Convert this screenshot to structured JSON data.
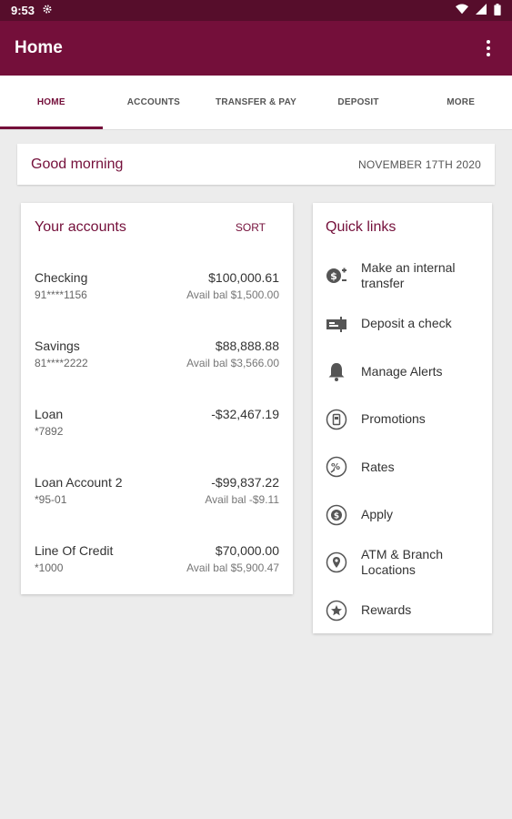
{
  "status": {
    "time": "9:53"
  },
  "appbar": {
    "title": "Home"
  },
  "tabs": [
    {
      "label": "HOME",
      "active": true
    },
    {
      "label": "ACCOUNTS"
    },
    {
      "label": "TRANSFER & PAY"
    },
    {
      "label": "DEPOSIT"
    },
    {
      "label": "MORE"
    }
  ],
  "greeting": {
    "text": "Good morning",
    "date": "NOVEMBER 17TH 2020"
  },
  "accounts": {
    "title": "Your accounts",
    "sort_label": "SORT",
    "items": [
      {
        "name": "Checking",
        "number": "91****1156",
        "amount": "$100,000.61",
        "avail": "Avail bal $1,500.00"
      },
      {
        "name": "Savings",
        "number": "81****2222",
        "amount": "$88,888.88",
        "avail": "Avail bal $3,566.00"
      },
      {
        "name": "Loan",
        "number": "*7892",
        "amount": "-$32,467.19",
        "avail": ""
      },
      {
        "name": "Loan Account 2",
        "number": "*95-01",
        "amount": "-$99,837.22",
        "avail": "Avail bal -$9.11"
      },
      {
        "name": "Line Of Credit",
        "number": "*1000",
        "amount": "$70,000.00",
        "avail": "Avail bal $5,900.47"
      }
    ]
  },
  "quick_links": {
    "title": "Quick links",
    "items": [
      {
        "label": "Make an internal transfer",
        "icon": "transfer-icon"
      },
      {
        "label": "Deposit a check",
        "icon": "check-deposit-icon"
      },
      {
        "label": "Manage Alerts",
        "icon": "bell-icon"
      },
      {
        "label": "Promotions",
        "icon": "promotions-icon"
      },
      {
        "label": "Rates",
        "icon": "rates-icon"
      },
      {
        "label": "Apply",
        "icon": "apply-icon"
      },
      {
        "label": "ATM & Branch Locations",
        "icon": "location-pin-icon"
      },
      {
        "label": "Rewards",
        "icon": "star-icon"
      }
    ]
  },
  "colors": {
    "brand": "#740f3a",
    "status_bar": "#560d2b",
    "background": "#ececec"
  }
}
